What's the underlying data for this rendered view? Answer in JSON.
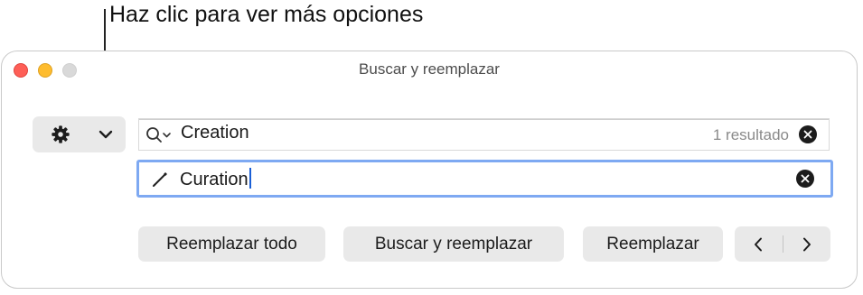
{
  "callout": {
    "text": "Haz clic para ver más opciones"
  },
  "window": {
    "title": "Buscar y reemplazar",
    "traffic_lights": [
      "close",
      "minimize",
      "zoom"
    ]
  },
  "options_button": {
    "icon": "gear-icon",
    "dropdown_icon": "chevron-down-icon"
  },
  "find_field": {
    "icon": "search-icon",
    "value": "Creation",
    "result_count": "1 resultado"
  },
  "replace_field": {
    "icon": "pencil-icon",
    "value": "Curation"
  },
  "buttons": {
    "replace_all": "Reemplazar todo",
    "find_and_replace": "Buscar y reemplazar",
    "replace": "Reemplazar"
  },
  "navigation": {
    "previous_icon": "chevron-left-icon",
    "next_icon": "chevron-right-icon"
  },
  "colors": {
    "close": "#fe5f57",
    "minimize": "#febc2e",
    "zoom": "#d9d9d9",
    "focus_ring": "#7ea9f2",
    "button_bg": "#e9e9e9"
  }
}
